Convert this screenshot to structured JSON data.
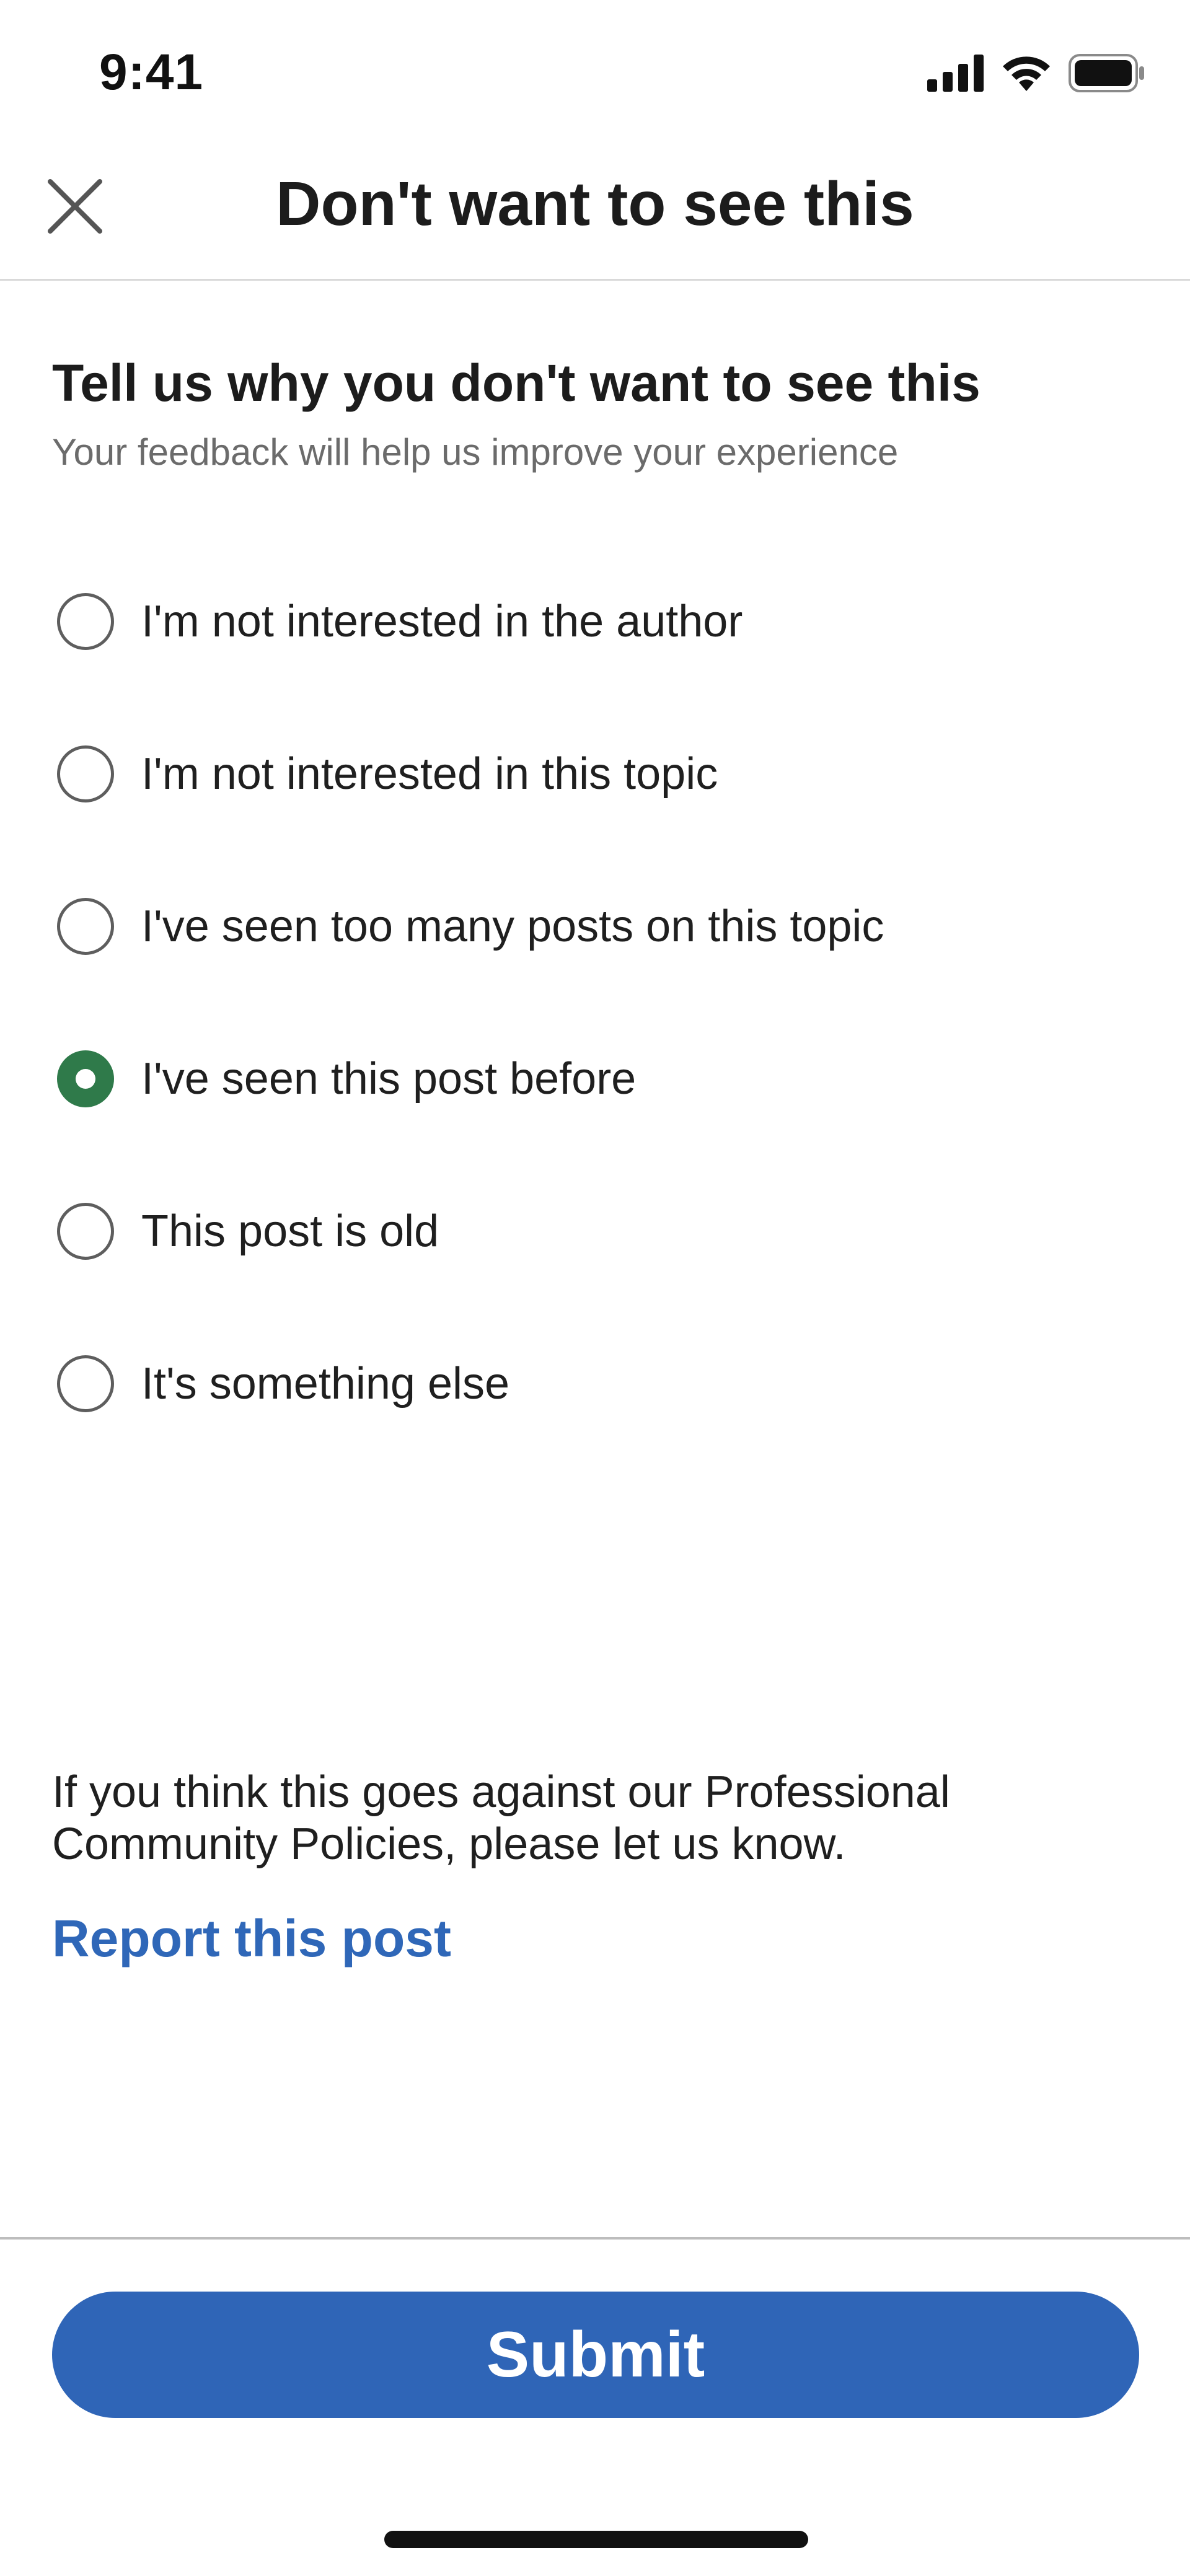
{
  "status_bar": {
    "time": "9:41",
    "icons": [
      "cellular-signal-icon",
      "wifi-icon",
      "battery-icon"
    ]
  },
  "header": {
    "title": "Don't want to see this",
    "close_icon": "close-icon"
  },
  "prompt": {
    "title": "Tell us why you don't want to see this",
    "subtitle": "Your feedback will help us improve your experience"
  },
  "options": [
    {
      "label": "I'm not interested in the author",
      "selected": false
    },
    {
      "label": "I'm not interested in this topic",
      "selected": false
    },
    {
      "label": "I've seen too many posts on this topic",
      "selected": false
    },
    {
      "label": "I've seen this post before",
      "selected": true
    },
    {
      "label": "This post is old",
      "selected": false
    },
    {
      "label": "It's something else",
      "selected": false
    }
  ],
  "policy": {
    "text_line1": "If you think this goes against our Professional",
    "text_line2": "Community Policies, please let us know.",
    "report_link": "Report this post"
  },
  "footer": {
    "submit_label": "Submit"
  },
  "colors": {
    "accent_blue": "#2f65b7",
    "link_blue": "#2f67b8",
    "selected_green": "#2f7a4a",
    "subtitle_gray": "#6b6b6b"
  }
}
